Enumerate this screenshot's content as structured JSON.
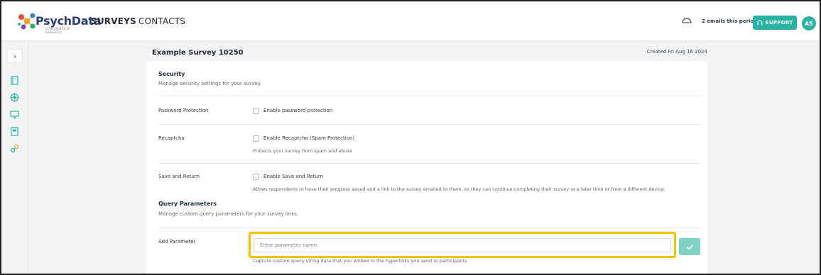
{
  "header": {
    "logo_text": "PsychData",
    "logo_tagline": "CONFIDENCE IN RESEARCH",
    "nav": [
      {
        "label": "SURVEYS"
      },
      {
        "label": "CONTACTS"
      }
    ],
    "emails_text": "2 emails this period",
    "support_label": "SUPPORT",
    "avatar_initials": "AS",
    "accent_color": "#2ab3a3"
  },
  "leftrail": {
    "expand_icon": "chevron-right-icon",
    "icons": [
      "book-icon",
      "target-icon",
      "monitor-icon",
      "document-icon",
      "link-icon"
    ]
  },
  "survey": {
    "title": "Example Survey 10250",
    "created": "Created Fri Aug 16 2024"
  },
  "security": {
    "title": "Security",
    "description": "Manage security settings for your survey.",
    "rows": [
      {
        "label": "Password Protection",
        "checkbox_label": "Enable password protection",
        "checked": false,
        "help": ""
      },
      {
        "label": "Recaptcha",
        "checkbox_label": "Enable Recaptcha (Spam Protection)",
        "checked": false,
        "help": "Protects your survey from spam and abuse"
      },
      {
        "label": "Save and Return",
        "checkbox_label": "Enable Save and Return",
        "checked": false,
        "help": "Allows respondents to have their progress saved and a link to the survey emailed to them, so they can continue completing their survey at a later time or from a different device."
      }
    ]
  },
  "query_params": {
    "title": "Query Parameters",
    "description": "Manage custom query parameters for your survey links.",
    "add_label": "Add Parameter",
    "input_placeholder": "Enter parameter name",
    "input_value": "",
    "help": "Capture custom query string data that you embed in the hyperlinks you send to participants",
    "highlight_color": "#f2c300"
  }
}
